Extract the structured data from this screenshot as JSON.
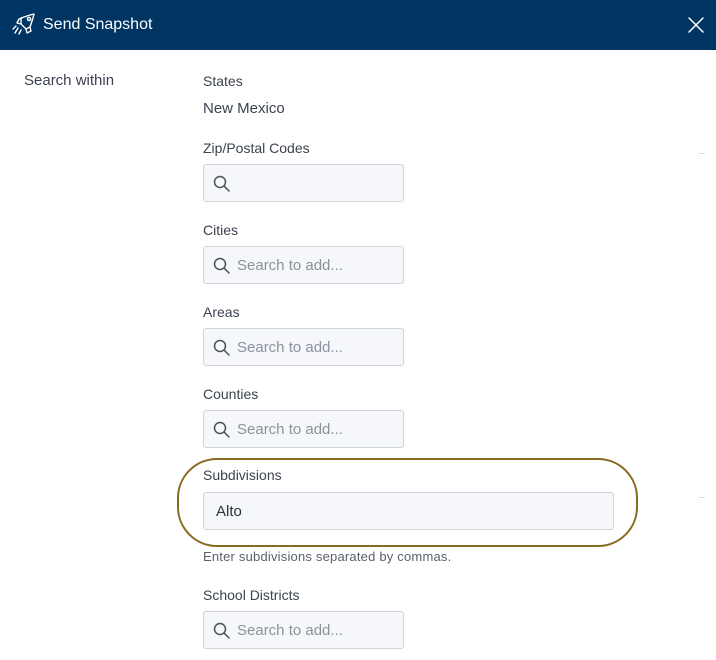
{
  "dialog": {
    "title": "Send Snapshot",
    "title_icon": "rocket-icon",
    "close_icon": "close-icon"
  },
  "section": {
    "label": "Search within"
  },
  "states": {
    "label": "States",
    "value": "New Mexico"
  },
  "zip": {
    "label": "Zip/Postal Codes",
    "placeholder": ""
  },
  "cities": {
    "label": "Cities",
    "placeholder": "Search to add..."
  },
  "areas": {
    "label": "Areas",
    "placeholder": "Search to add..."
  },
  "counties": {
    "label": "Counties",
    "placeholder": "Search to add..."
  },
  "subdivisions": {
    "label": "Subdivisions",
    "value": "Alto",
    "help": "Enter subdivisions separated by commas."
  },
  "school_districts": {
    "label": "School Districts",
    "placeholder": "Search to add..."
  },
  "colors": {
    "header_bg": "#003462",
    "highlight": "#8a6a1e"
  }
}
